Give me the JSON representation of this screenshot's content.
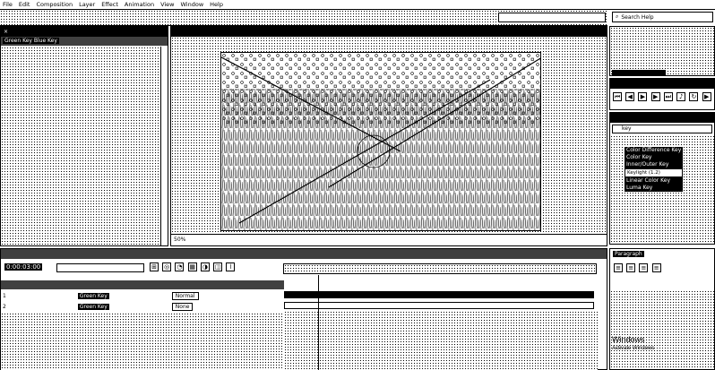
{
  "menu": {
    "items": [
      "File",
      "Edit",
      "Composition",
      "Layer",
      "Effect",
      "Animation",
      "View",
      "Window",
      "Help"
    ]
  },
  "search_help": {
    "placeholder": "Search Help"
  },
  "project_panel": {
    "item": "Green Key Blue Key"
  },
  "comp_panel": {
    "zoom": "50%"
  },
  "effects_panel": {
    "search_value": "key",
    "items": [
      "Color Difference Key",
      "Color Key",
      "Inner/Outer Key",
      "Keylight (1.2)",
      "Linear Color Key",
      "Luma Key"
    ]
  },
  "timeline": {
    "timecode": "0:00:03:00",
    "search_placeholder": "",
    "layers": [
      {
        "num": "1",
        "name": "Green Key",
        "mode": "Normal"
      },
      {
        "num": "2",
        "name": "Green Key",
        "mode": "None"
      }
    ]
  },
  "paragraph_panel": {
    "title": "Paragraph"
  },
  "watermark": {
    "line1": "Windows",
    "line2": "Activate Windows"
  }
}
